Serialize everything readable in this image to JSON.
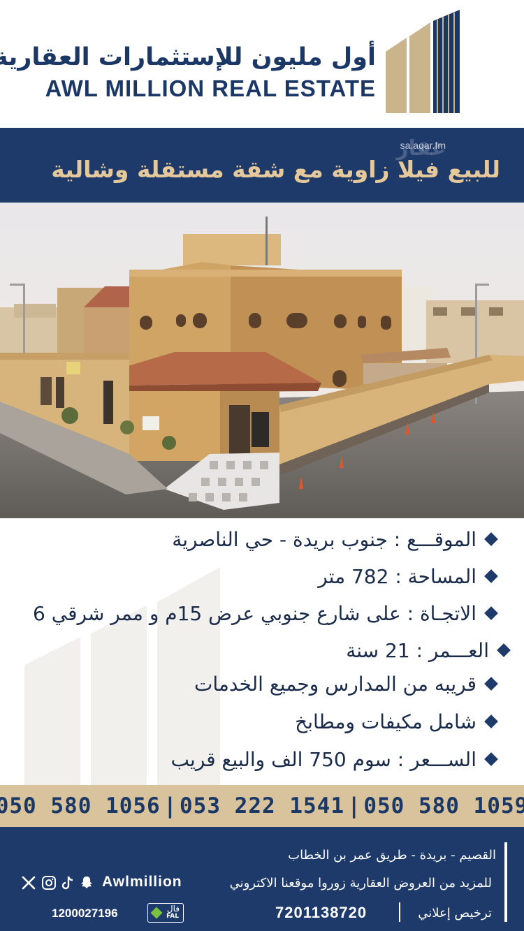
{
  "header": {
    "brand_ar": "أول مليون للإستثمارات العقارية",
    "brand_en": "AWL MILLION REAL ESTATE"
  },
  "title_band": {
    "title": "للبيع فيلا زاوية مع شقة مستقلة وشالية",
    "watermark": "عقار",
    "watermark_url": "sa.aqar.fm"
  },
  "details": [
    {
      "text": "الموقـــع : جنوب بريدة - حي الناصرية"
    },
    {
      "text": "المساحة :  782 متر"
    },
    {
      "text": "الاتجـاة :  على شارع جنوبي عرض 15م و ممر شرقي 6"
    },
    {
      "text": "العـــمر : 21 سنة"
    },
    {
      "text": "قريبه من المدارس وجميع الخدمات"
    },
    {
      "text": "شامل مكيفات ومطابخ"
    },
    {
      "text": "الســـعر : سوم 750 الف والبيع قريب"
    }
  ],
  "phones": [
    "050 580 1056",
    "053 222 1541",
    "050 580 1059"
  ],
  "footer": {
    "address": "القصيم - بريدة - طريق عمر بن الخطاب",
    "more_info": "للمزيد من العروض العقارية زوروا موقعنا الاكتروني",
    "license_label": "ترخيص إعلاني",
    "license_number": "7201138720",
    "social_handle": "Awlmillion",
    "fal_number": "1200027196",
    "fal_ar": "فال",
    "fal_en": "FAL"
  },
  "icons": [
    "x-icon",
    "instagram-icon",
    "tiktok-icon",
    "snapchat-icon"
  ],
  "colors": {
    "navy": "#1e3a6b",
    "gold": "#d8c39d",
    "title_gold": "#e6c99a"
  }
}
